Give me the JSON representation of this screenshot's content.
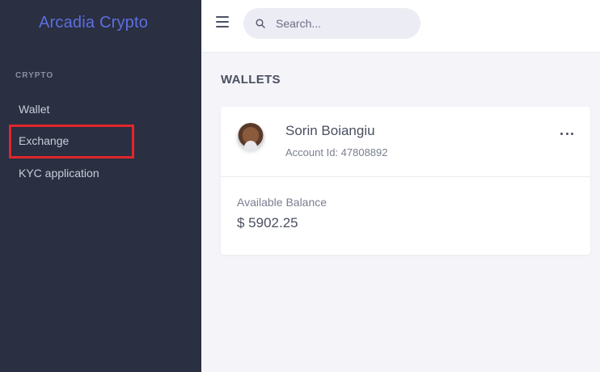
{
  "sidebar": {
    "brand": "Arcadia Crypto",
    "section_title": "CRYPTO",
    "items": [
      {
        "label": "Wallet"
      },
      {
        "label": "Exchange"
      },
      {
        "label": "KYC application"
      }
    ]
  },
  "topbar": {
    "search_placeholder": "Search..."
  },
  "main": {
    "page_title": "WALLETS",
    "wallet": {
      "name": "Sorin Boiangiu",
      "account_id": "Account Id: 47808892",
      "balance_label": "Available Balance",
      "balance_value": "$ 5902.25"
    }
  },
  "colors": {
    "sidebar_bg": "#2a2f42",
    "brand": "#5c6fe0",
    "highlight": "#e0262b",
    "page_bg": "#f5f5f9"
  }
}
